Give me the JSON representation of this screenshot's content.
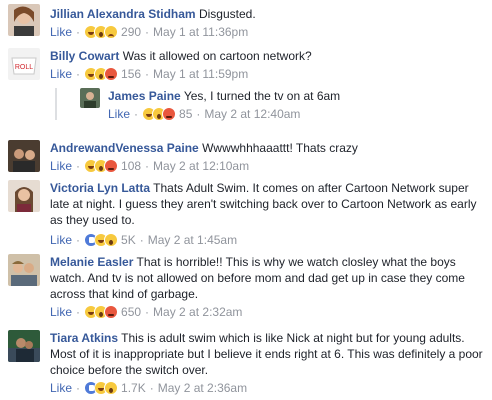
{
  "common": {
    "like_label": "Like",
    "sep": "·"
  },
  "comments": [
    {
      "name": "Jillian Alexandra Stidham",
      "text": "Disgusted.",
      "reactions": [
        "haha",
        "wow",
        "sad"
      ],
      "count": "290",
      "time": "May 1 at 11:36pm"
    },
    {
      "name": "Billy Cowart",
      "text": "Was it allowed on cartoon network?",
      "reactions": [
        "haha",
        "wow",
        "angry"
      ],
      "count": "156",
      "time": "May 1 at 11:59pm"
    },
    {
      "name": "James Paine",
      "text": "Yes, I turned the tv on at 6am",
      "reactions": [
        "haha",
        "wow",
        "angry"
      ],
      "count": "85",
      "time": "May 2 at 12:40am"
    },
    {
      "name": "AndrewandVenessa Paine",
      "text": "Wwwwhhhaaattt! Thats crazy",
      "reactions": [
        "haha",
        "wow",
        "angry"
      ],
      "count": "108",
      "time": "May 2 at 12:10am"
    },
    {
      "name": "Victoria Lyn Latta",
      "text": "Thats Adult Swim. It comes on after Cartoon Network super late at night. I guess they aren't switching back over to Cartoon Network as early as they used to.",
      "reactions": [
        "like-r",
        "haha",
        "wow"
      ],
      "count": "5K",
      "time": "May 2 at 1:45am"
    },
    {
      "name": "Melanie Easler",
      "text": "That is horrible!! This is why we watch closley what the boys watch. And tv is not allowed on before mom and dad get up in case they come across that kind of garbage.",
      "reactions": [
        "haha",
        "wow",
        "angry"
      ],
      "count": "650",
      "time": "May 2 at 2:32am"
    },
    {
      "name": "Tiara Atkins",
      "text": "This is adult swim which is like Nick at night but for young adults. Most of it is inappropriate but I believe it ends right at 6. This was definitely a poor choice before the switch over.",
      "reactions": [
        "like-r",
        "haha",
        "wow"
      ],
      "count": "1.7K",
      "time": "May 2 at 2:36am"
    }
  ],
  "colors": {
    "name": "#365899",
    "like": "#4267b2",
    "meta": "#90949c",
    "text": "#1d2129"
  }
}
